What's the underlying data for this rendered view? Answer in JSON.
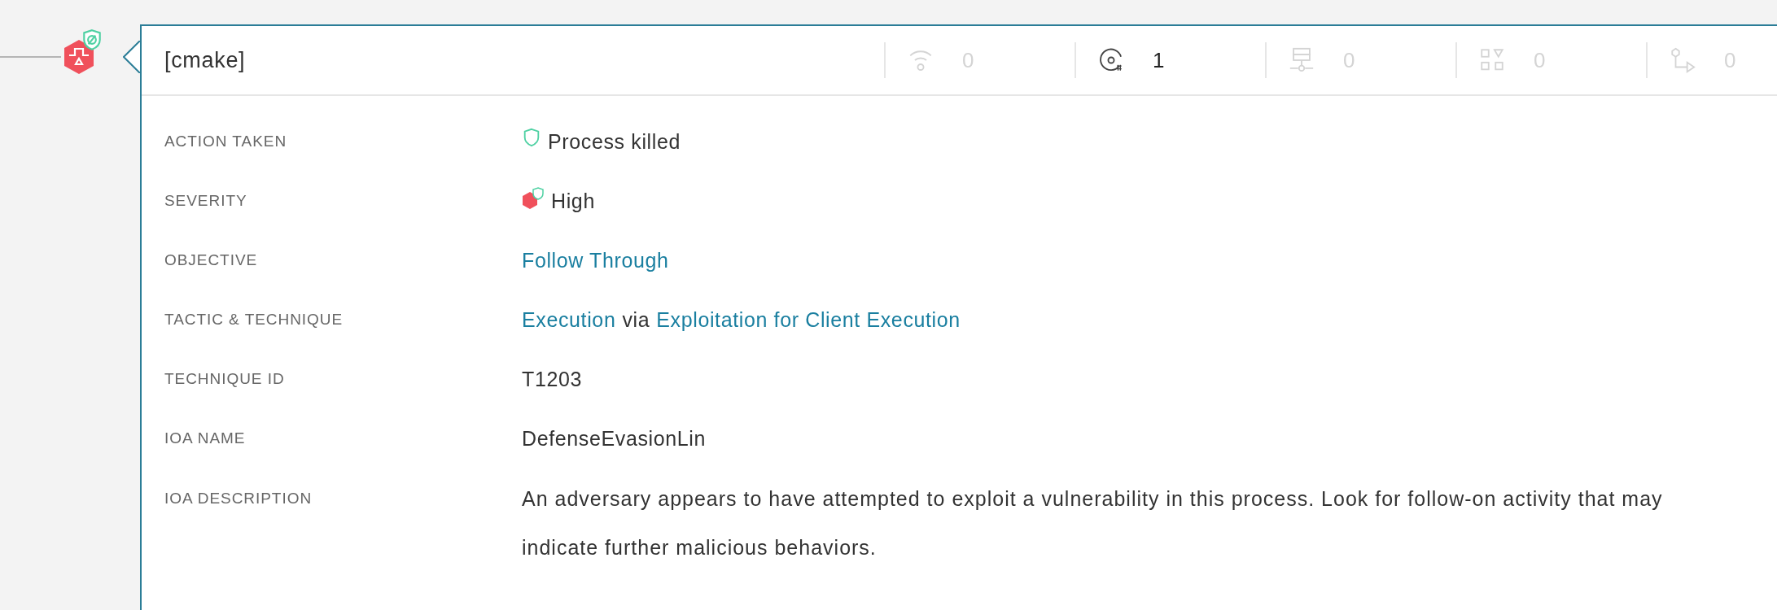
{
  "detection": {
    "title": "[cmake]",
    "stats": [
      {
        "kind": "network",
        "value": "0",
        "active": false
      },
      {
        "kind": "disk",
        "value": "1",
        "active": true
      },
      {
        "kind": "registry",
        "value": "0",
        "active": false
      },
      {
        "kind": "modules",
        "value": "0",
        "active": false
      },
      {
        "kind": "dns",
        "value": "0",
        "active": false
      }
    ],
    "details": [
      {
        "label": "ACTION TAKEN",
        "kind": "action",
        "parts": [
          {
            "text": "Process killed",
            "link": false
          }
        ]
      },
      {
        "label": "SEVERITY",
        "kind": "severity",
        "parts": [
          {
            "text": "High",
            "link": false
          }
        ]
      },
      {
        "label": "OBJECTIVE",
        "kind": "text",
        "parts": [
          {
            "text": "Follow Through",
            "link": true
          }
        ]
      },
      {
        "label": "TACTIC & TECHNIQUE",
        "kind": "text",
        "parts": [
          {
            "text": "Execution",
            "link": true
          },
          {
            "text": "via",
            "link": false
          },
          {
            "text": "Exploitation for Client Execution",
            "link": true
          }
        ]
      },
      {
        "label": "TECHNIQUE ID",
        "kind": "text",
        "parts": [
          {
            "text": "T1203",
            "link": false
          }
        ]
      },
      {
        "label": "IOA NAME",
        "kind": "text",
        "parts": [
          {
            "text": "DefenseEvasionLin",
            "link": false
          }
        ]
      },
      {
        "label": "IOA DESCRIPTION",
        "kind": "paragraph",
        "parts": [
          {
            "text": "An adversary appears to have attempted to exploit a vulnerability in this process. Look for follow-on activity that may indicate further malicious behaviors.",
            "link": false
          }
        ]
      }
    ]
  }
}
